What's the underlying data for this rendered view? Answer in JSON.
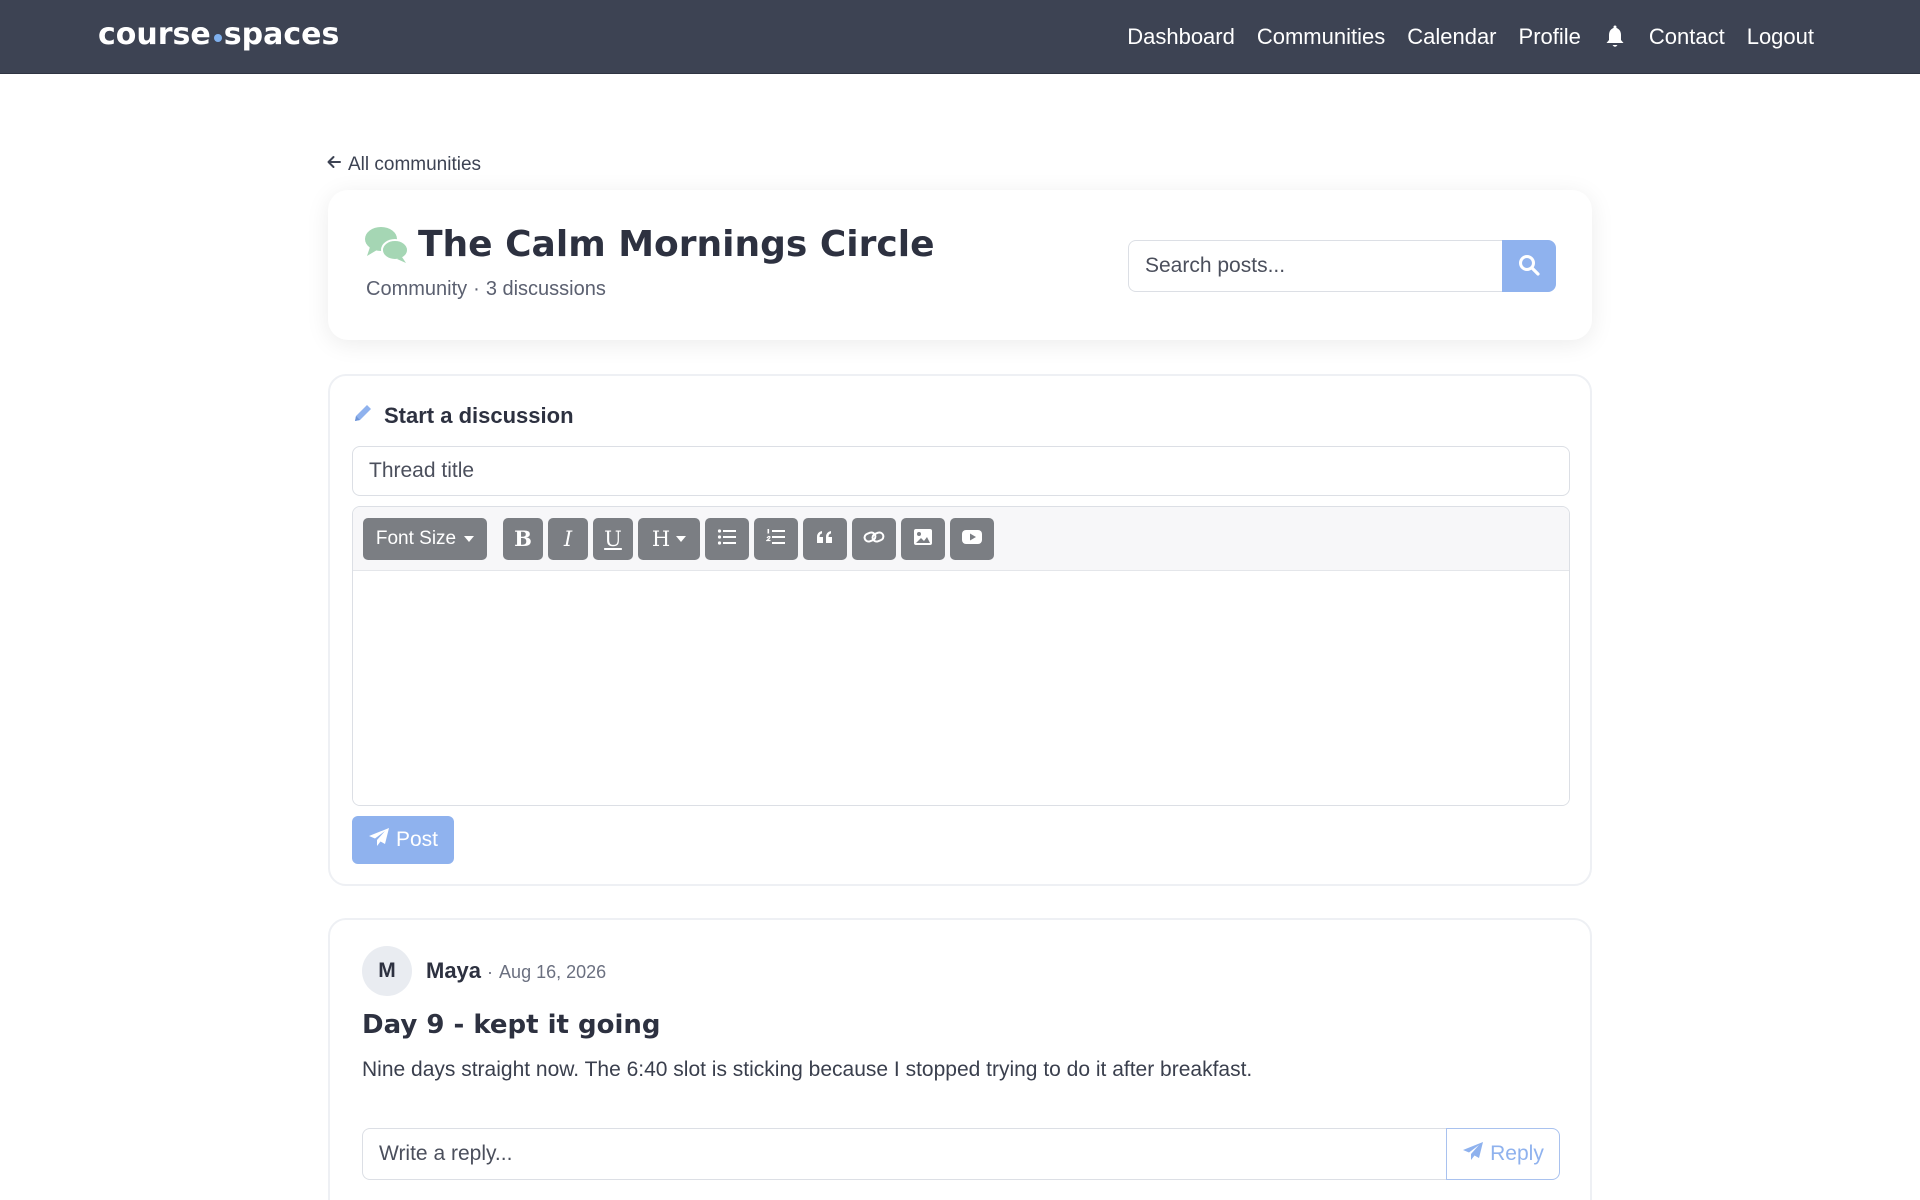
{
  "nav": {
    "brand_left": "course",
    "brand_right": "spaces",
    "links": {
      "dashboard": "Dashboard",
      "communities": "Communities",
      "calendar": "Calendar",
      "profile": "Profile",
      "contact": "Contact",
      "logout": "Logout"
    },
    "notifications_icon": "bell-icon"
  },
  "back_link": "All communities",
  "community": {
    "title": "The Calm Mornings Circle",
    "type": "Community",
    "separator": "·",
    "discussions": "3 discussions",
    "icon": "comments-icon",
    "icon_color": "#a5d6b4"
  },
  "search": {
    "placeholder": "Search posts...",
    "button_icon": "search-icon"
  },
  "compose": {
    "heading": "Start a discussion",
    "heading_icon": "pencil-icon",
    "title_placeholder": "Thread title",
    "toolbar": {
      "font_size": "Font Size",
      "bold": "B",
      "italic": "I",
      "underline": "U",
      "heading": "H"
    },
    "post_label": "Post"
  },
  "posts": [
    {
      "avatar_initial": "M",
      "author": "Maya",
      "separator": "·",
      "date": "Aug 16, 2026",
      "title": "Day 9 - kept it going",
      "body": "Nine days straight now. The 6:40 slot is sticking because I stopped trying to do it after breakfast.",
      "reply_placeholder": "Write a reply...",
      "reply_label": "Reply"
    }
  ],
  "colors": {
    "navbar": "#3d4353",
    "accent": "#8fb2ee",
    "toolbar_button": "#7b7e83"
  }
}
